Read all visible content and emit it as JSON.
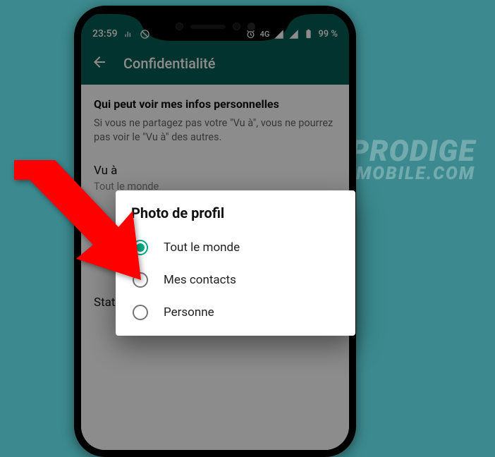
{
  "statusbar": {
    "time": "23:59",
    "network_label": "4G",
    "battery_pct": "99 %"
  },
  "appbar": {
    "title": "Confidentialité"
  },
  "page": {
    "section_heading": "Qui peut voir mes infos personnelles",
    "section_description": "Si vous ne partagez pas votre \"Vu à\", vous ne pourrez pas voir le \"Vu à\" des autres.",
    "pref_lastseen": {
      "title": "Vu à",
      "value": "Tout le monde"
    },
    "pref_status": {
      "title": "Statut"
    }
  },
  "dialog": {
    "title": "Photo de profil",
    "options": [
      {
        "label": "Tout le monde",
        "selected": true
      },
      {
        "label": "Mes contacts",
        "selected": false
      },
      {
        "label": "Personne",
        "selected": false
      }
    ]
  },
  "watermark": {
    "line1": "PRODIGE",
    "line2": "MOBILE.COM"
  }
}
